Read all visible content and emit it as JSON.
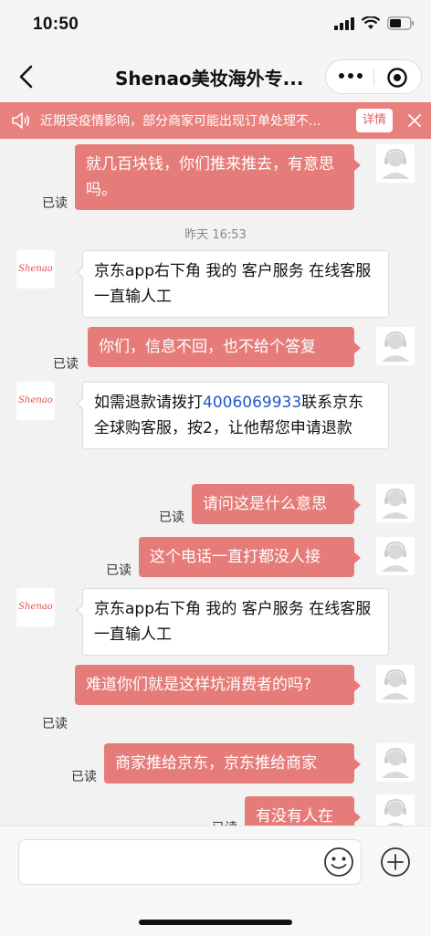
{
  "status": {
    "time": "10:50"
  },
  "nav": {
    "title": "Shenao美妆海外专..."
  },
  "notice": {
    "text": "近期受疫情影响，部分商家可能出现订单处理不...",
    "button": "详情"
  },
  "shop_avatar_text": "Shenao",
  "read_label": "已读",
  "messages": [
    {
      "from": "me",
      "text": "就几百块钱，你们推来推去，有意思吗。"
    },
    {
      "timestamp": "昨天 16:53"
    },
    {
      "from": "shop",
      "text": "京东app右下角 我的 客户服务 在线客服 一直输人工"
    },
    {
      "from": "me",
      "text": "你们，信息不回，也不给个答复"
    },
    {
      "from": "shop",
      "text_before": "如需退款请拨打",
      "phone": "4006069933",
      "text_after": "联系京东全球购客服，按2，让他帮您申请退款"
    },
    {
      "from": "me",
      "text": "请问这是什么意思"
    },
    {
      "from": "me",
      "text": "这个电话一直打都没人接"
    },
    {
      "from": "shop",
      "text": "京东app右下角 我的 客户服务 在线客服 一直输人工"
    },
    {
      "from": "me",
      "text": "难道你们就是这样坑消费者的吗?"
    },
    {
      "from": "me",
      "text": "商家推给京东，京东推给商家"
    },
    {
      "from": "me",
      "text": "有没有人在"
    }
  ],
  "colors": {
    "accent": "#e57c79",
    "notice_bg": "#e8807d",
    "link": "#2255cc"
  },
  "icons": [
    "back-arrow-icon",
    "more-dots-icon",
    "mini-program-close-icon",
    "speaker-icon",
    "close-icon",
    "user-avatar-icon",
    "emoji-icon",
    "plus-icon",
    "signal-icon",
    "wifi-icon",
    "battery-icon"
  ]
}
